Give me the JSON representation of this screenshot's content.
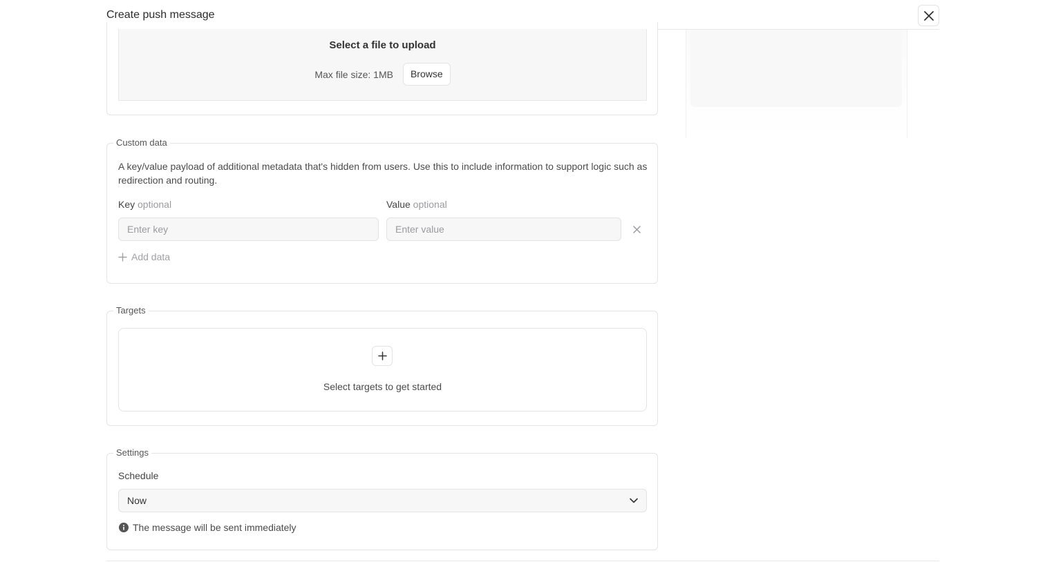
{
  "header": {
    "title": "Create push message"
  },
  "upload": {
    "title": "Select a file to upload",
    "hint": "Max file size: 1MB",
    "browse_label": "Browse"
  },
  "custom_data": {
    "legend": "Custom data",
    "description": "A key/value payload of additional metadata that's hidden from users. Use this to include information to support logic such as redirection and routing.",
    "key_label": "Key",
    "key_optional": "optional",
    "key_placeholder": "Enter key",
    "value_label": "Value",
    "value_optional": "optional",
    "value_placeholder": "Enter value",
    "add_label": "Add data"
  },
  "targets": {
    "legend": "Targets",
    "empty_text": "Select targets to get started"
  },
  "settings": {
    "legend": "Settings",
    "schedule_label": "Schedule",
    "schedule_value": "Now",
    "info_text": "The message will be sent immediately"
  },
  "icons": {
    "close": "close-icon",
    "remove": "x-icon",
    "add": "plus-icon",
    "chevron": "chevron-down-icon",
    "info": "info-icon"
  }
}
